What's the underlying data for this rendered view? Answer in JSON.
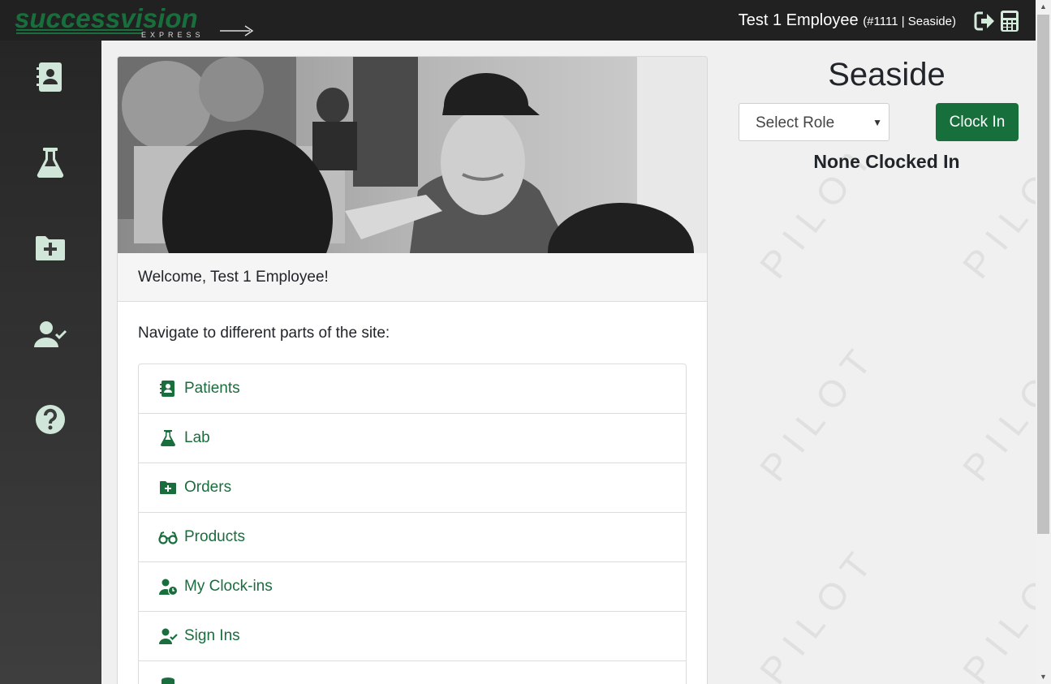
{
  "header": {
    "logo_text": "successvision",
    "logo_sub": "EXPRESS",
    "user_name": "Test 1 Employee",
    "user_meta": "(#1111 | Seaside)"
  },
  "sidebar": {
    "items": [
      {
        "name": "patients",
        "icon": "address-book-icon"
      },
      {
        "name": "lab",
        "icon": "flask-icon"
      },
      {
        "name": "orders",
        "icon": "folder-plus-icon"
      },
      {
        "name": "sign-ins",
        "icon": "user-check-icon"
      },
      {
        "name": "help",
        "icon": "question-circle-icon"
      }
    ]
  },
  "main": {
    "welcome": "Welcome, Test 1 Employee!",
    "nav_intro": "Navigate to different parts of the site:",
    "nav_items": [
      {
        "label": "Patients",
        "icon": "address-book-icon"
      },
      {
        "label": "Lab",
        "icon": "flask-icon"
      },
      {
        "label": "Orders",
        "icon": "folder-plus-icon"
      },
      {
        "label": "Products",
        "icon": "glasses-icon"
      },
      {
        "label": "My Clock-ins",
        "icon": "user-clock-icon"
      },
      {
        "label": "Sign Ins",
        "icon": "user-check-icon"
      }
    ]
  },
  "panel": {
    "location": "Seaside",
    "role_placeholder": "Select Role",
    "clock_in_label": "Clock In",
    "status": "None Clocked In",
    "watermark": "PILOT"
  },
  "colors": {
    "brand_green": "#17703c",
    "icon_light": "#cfe6d9",
    "topbar": "#212121"
  }
}
